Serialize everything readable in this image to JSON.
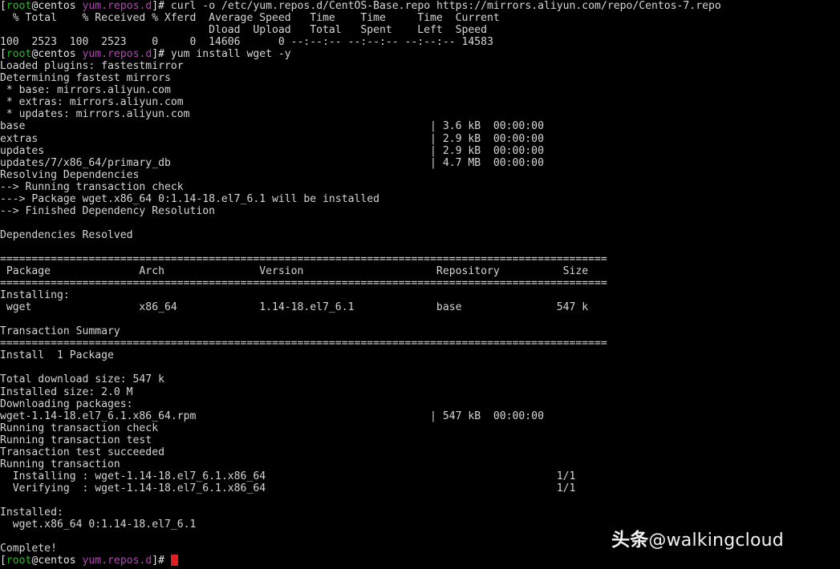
{
  "terminal": {
    "title": "Terminal — yum install wget",
    "cols": 112,
    "rows": 47,
    "background": "#000000",
    "foreground": "#d6d6d6",
    "cursor_color": "#e02020",
    "prompt": {
      "bracket_open": "[",
      "user": "root",
      "at_host": "@centos",
      "cwd": "yum.repos.d",
      "bracket_close": "]# ",
      "user_color": "#2fb82f",
      "cwd_color": "#b048b0"
    },
    "commands": {
      "curl": "curl -o /etc/yum.repos.d/CentOS-Base.repo https://mirrors.aliyun.com/repo/Centos-7.repo",
      "yum": "yum install wget -y"
    },
    "lines": [
      {
        "type": "prompt",
        "cmd": "curl -o /etc/yum.repos.d/CentOS-Base.repo https://mirrors.aliyun.com/repo/Centos-7.repo"
      },
      {
        "type": "text",
        "text": "  % Total    % Received % Xferd  Average Speed   Time    Time     Time  Current"
      },
      {
        "type": "text",
        "text": "                                 Dload  Upload   Total   Spent    Left  Speed"
      },
      {
        "type": "text",
        "text": "100  2523  100  2523    0     0  14606      0 --:--:-- --:--:-- --:--:-- 14583"
      },
      {
        "type": "prompt",
        "cmd": "yum install wget -y"
      },
      {
        "type": "text",
        "text": "Loaded plugins: fastestmirror"
      },
      {
        "type": "text",
        "text": "Determining fastest mirrors"
      },
      {
        "type": "text",
        "text": " * base: mirrors.aliyun.com"
      },
      {
        "type": "text",
        "text": " * extras: mirrors.aliyun.com"
      },
      {
        "type": "text",
        "text": " * updates: mirrors.aliyun.com"
      },
      {
        "type": "text",
        "text": "base                                                                | 3.6 kB  00:00:00"
      },
      {
        "type": "text",
        "text": "extras                                                              | 2.9 kB  00:00:00"
      },
      {
        "type": "text",
        "text": "updates                                                             | 2.9 kB  00:00:00"
      },
      {
        "type": "text",
        "text": "updates/7/x86_64/primary_db                                         | 4.7 MB  00:00:00"
      },
      {
        "type": "text",
        "text": "Resolving Dependencies"
      },
      {
        "type": "text",
        "text": "--> Running transaction check"
      },
      {
        "type": "text",
        "text": "---> Package wget.x86_64 0:1.14-18.el7_6.1 will be installed"
      },
      {
        "type": "text",
        "text": "--> Finished Dependency Resolution"
      },
      {
        "type": "text",
        "text": ""
      },
      {
        "type": "text",
        "text": "Dependencies Resolved"
      },
      {
        "type": "text",
        "text": ""
      },
      {
        "type": "text",
        "text": "================================================================================================"
      },
      {
        "type": "text",
        "text": " Package              Arch               Version                     Repository          Size"
      },
      {
        "type": "text",
        "text": "================================================================================================"
      },
      {
        "type": "text",
        "text": "Installing:"
      },
      {
        "type": "text",
        "text": " wget                 x86_64             1.14-18.el7_6.1             base               547 k"
      },
      {
        "type": "text",
        "text": ""
      },
      {
        "type": "text",
        "text": "Transaction Summary"
      },
      {
        "type": "text",
        "text": "================================================================================================"
      },
      {
        "type": "text",
        "text": "Install  1 Package"
      },
      {
        "type": "text",
        "text": ""
      },
      {
        "type": "text",
        "text": "Total download size: 547 k"
      },
      {
        "type": "text",
        "text": "Installed size: 2.0 M"
      },
      {
        "type": "text",
        "text": "Downloading packages:"
      },
      {
        "type": "text",
        "text": "wget-1.14-18.el7_6.1.x86_64.rpm                                     | 547 kB  00:00:00"
      },
      {
        "type": "text",
        "text": "Running transaction check"
      },
      {
        "type": "text",
        "text": "Running transaction test"
      },
      {
        "type": "text",
        "text": "Transaction test succeeded"
      },
      {
        "type": "text",
        "text": "Running transaction"
      },
      {
        "type": "text",
        "text": "  Installing : wget-1.14-18.el7_6.1.x86_64                                              1/1 "
      },
      {
        "type": "text",
        "text": "  Verifying  : wget-1.14-18.el7_6.1.x86_64                                              1/1 "
      },
      {
        "type": "text",
        "text": ""
      },
      {
        "type": "text",
        "text": "Installed:"
      },
      {
        "type": "text",
        "text": "  wget.x86_64 0:1.14-18.el7_6.1"
      },
      {
        "type": "text",
        "text": ""
      },
      {
        "type": "text",
        "text": "Complete!"
      },
      {
        "type": "prompt_cursor",
        "cmd": ""
      }
    ],
    "transfer_stats": {
      "percent_total": "100",
      "total": "2523",
      "percent_received": "100",
      "received": "2523",
      "percent_xferd": "0",
      "xferd": "0",
      "dload": "14606",
      "upload": "0",
      "time_total": "--:--:--",
      "time_spent": "--:--:--",
      "time_left": "--:--:--",
      "current_speed": "14583"
    },
    "repo_metadata": [
      {
        "name": "base",
        "size": "3.6 kB",
        "time": "00:00:00"
      },
      {
        "name": "extras",
        "size": "2.9 kB",
        "time": "00:00:00"
      },
      {
        "name": "updates",
        "size": "2.9 kB",
        "time": "00:00:00"
      },
      {
        "name": "updates/7/x86_64/primary_db",
        "size": "4.7 MB",
        "time": "00:00:00"
      }
    ],
    "mirrors": [
      {
        "repo": "base",
        "host": "mirrors.aliyun.com"
      },
      {
        "repo": "extras",
        "host": "mirrors.aliyun.com"
      },
      {
        "repo": "updates",
        "host": "mirrors.aliyun.com"
      }
    ],
    "package_table": {
      "headers": [
        "Package",
        "Arch",
        "Version",
        "Repository",
        "Size"
      ],
      "section": "Installing:",
      "rows": [
        {
          "package": "wget",
          "arch": "x86_64",
          "version": "1.14-18.el7_6.1",
          "repository": "base",
          "size": "547 k"
        }
      ]
    },
    "summary": {
      "heading": "Transaction Summary",
      "install_line": "Install  1 Package",
      "total_download_size": "547 k",
      "installed_size": "2.0 M",
      "downloaded_rpm": "wget-1.14-18.el7_6.1.x86_64.rpm",
      "downloaded_rpm_size": "547 kB",
      "downloaded_rpm_time": "00:00:00"
    },
    "transaction_steps": [
      {
        "action": "Installing",
        "target": "wget-1.14-18.el7_6.1.x86_64",
        "counter": "1/1"
      },
      {
        "action": "Verifying",
        "target": "wget-1.14-18.el7_6.1.x86_64",
        "counter": "1/1"
      }
    ],
    "installed": {
      "heading": "Installed:",
      "package": "wget.x86_64 0:1.14-18.el7_6.1"
    },
    "final_status": "Complete!"
  },
  "watermark": {
    "logo_text": "头条",
    "handle": "@walkingcloud",
    "color": "#f2f2f2"
  }
}
